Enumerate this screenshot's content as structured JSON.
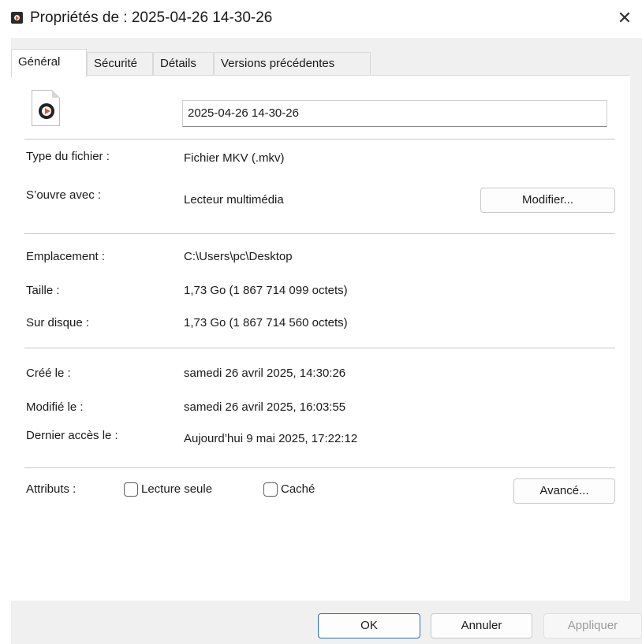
{
  "window": {
    "title": "Propriétés de : 2025-04-26 14-30-26",
    "title_icon": "media-file-icon",
    "close_glyph": "✕"
  },
  "tabs": [
    {
      "label": "Général",
      "active": true
    },
    {
      "label": "Sécurité",
      "active": false
    },
    {
      "label": "Détails",
      "active": false
    },
    {
      "label": "Versions précédentes",
      "active": false
    }
  ],
  "general": {
    "file_icon": "mkv-media-file-icon",
    "file_name": "2025-04-26 14-30-26",
    "type_label": "Type du fichier :",
    "type_value": "Fichier MKV (.mkv)",
    "opens_with_label": "S’ouvre avec :",
    "opens_with_value": "Lecteur multimédia",
    "change_button": "Modifier...",
    "location_label": "Emplacement :",
    "location_value": "C:\\Users\\pc\\Desktop",
    "size_label": "Taille :",
    "size_value": "1,73 Go (1 867 714 099 octets)",
    "size_on_disk_label": "Sur disque :",
    "size_on_disk_value": "1,73 Go (1 867 714 560 octets)",
    "created_label": "Créé le :",
    "created_value": "samedi 26 avril 2025, 14:30:26",
    "modified_label": "Modifié le :",
    "modified_value": "samedi 26 avril 2025, 16:03:55",
    "accessed_label": "Dernier accès le :",
    "accessed_value": "Aujourd’hui 9 mai 2025, 17:22:12",
    "attributes_label": "Attributs :",
    "readonly_label": "Lecture seule",
    "readonly_checked": false,
    "hidden_label": "Caché",
    "hidden_checked": false,
    "advanced_button": "Avancé..."
  },
  "footer": {
    "ok": "OK",
    "cancel": "Annuler",
    "apply": "Appliquer",
    "apply_enabled": false
  },
  "colors": {
    "default_button_border": "#2f6fb5",
    "dialog_background": "#f0f0f0",
    "panel_background": "#ffffff"
  }
}
